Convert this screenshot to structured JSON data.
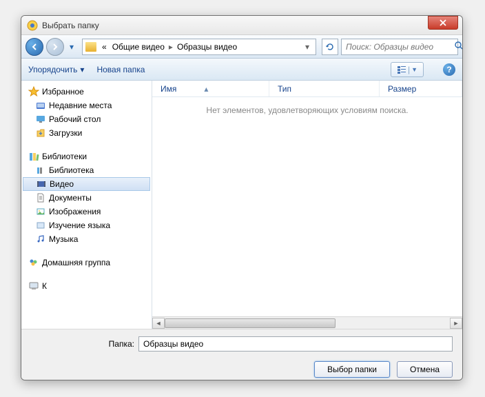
{
  "title": "Выбрать папку",
  "breadcrumb": {
    "prefix": "«",
    "p1": "Общие видео",
    "p2": "Образцы видео"
  },
  "search": {
    "placeholder": "Поиск: Образцы видео"
  },
  "toolbar": {
    "organize": "Упорядочить",
    "newfolder": "Новая папка"
  },
  "sidebar": {
    "favorites": {
      "label": "Избранное",
      "items": [
        "Недавние места",
        "Рабочий стол",
        "Загрузки"
      ]
    },
    "libraries": {
      "label": "Библиотеки",
      "items": [
        "Библиотека",
        "Видео",
        "Документы",
        "Изображения",
        "Изучение языка",
        "Музыка"
      ],
      "selected": 1
    },
    "homegroup": {
      "label": "Домашняя группа"
    },
    "computer": {
      "label": "К"
    }
  },
  "columns": {
    "name": "Имя",
    "type": "Тип",
    "size": "Размер"
  },
  "empty": "Нет элементов, удовлетворяющих условиям поиска.",
  "folder": {
    "label": "Папка:",
    "value": "Образцы видео"
  },
  "buttons": {
    "select": "Выбор папки",
    "cancel": "Отмена"
  }
}
